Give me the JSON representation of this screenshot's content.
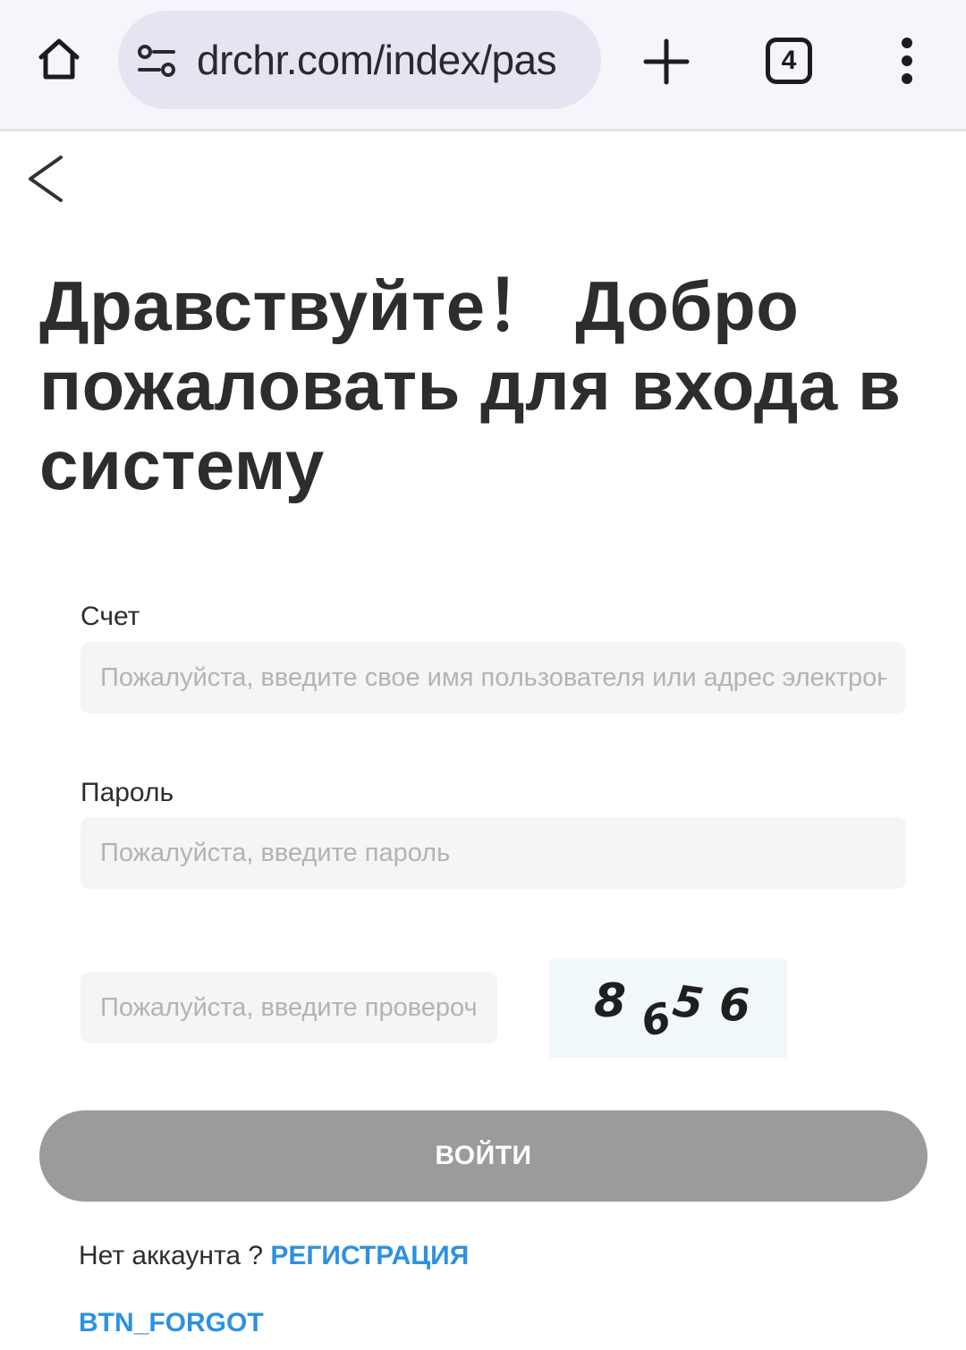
{
  "browser": {
    "url": "drchr.com/index/pas",
    "tab_count": "4",
    "icons": {
      "home": "home-icon",
      "site_info": "tune-icon",
      "new_tab": "plus-icon",
      "tabs": "tab-switcher-icon",
      "menu": "kebab-menu-icon"
    }
  },
  "page": {
    "back_icon": "chevron-left-icon",
    "title": "Дравствуйте！ Добро пожаловать для входа в систему",
    "account": {
      "label": "Счет",
      "placeholder": "Пожалуйста, введите свое имя пользователя или адрес электронной почты"
    },
    "password": {
      "label": "Пароль",
      "placeholder": "Пожалуйста, введите пароль"
    },
    "captcha": {
      "placeholder": "Пожалуйста, введите проверочный код",
      "image_code": "8656"
    },
    "login_button": "ВОЙТИ",
    "register_prompt": "Нет аккаунта ? ",
    "register_link": "РЕГИСТРАЦИЯ",
    "forgot_link": "BTN_FORGOT"
  },
  "colors": {
    "browser_bar": "#f7f5fb",
    "url_pill": "#e6e4f0",
    "input_bg": "#f5f5f5",
    "button_disabled": "#9b9b9b",
    "link": "#2e91e0",
    "captcha_bg": "#f1f8fc"
  }
}
